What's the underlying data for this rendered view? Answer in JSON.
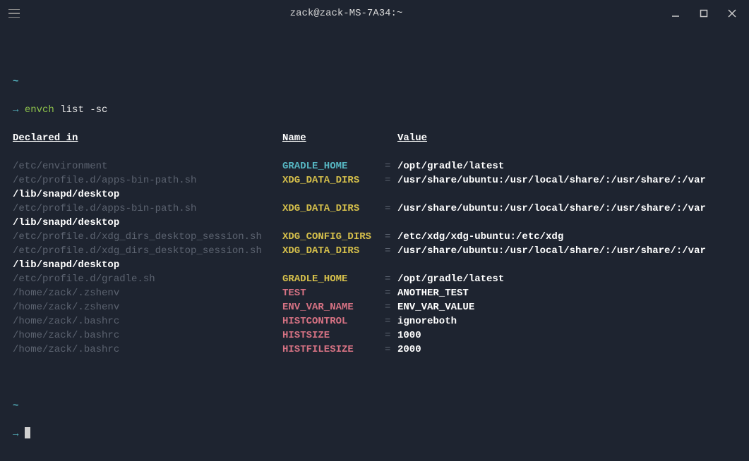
{
  "window": {
    "title": "zack@zack-MS-7A34:~"
  },
  "prompt": {
    "cwd": "~",
    "arrow": "→",
    "command": "envch",
    "args": "list -sc"
  },
  "headers": {
    "declared": "Declared in",
    "name": "Name",
    "value": "Value"
  },
  "eq": "=",
  "rows": [
    {
      "declared": "/etc/environment",
      "name": "GRADLE_HOME",
      "value": "/opt/gradle/latest",
      "nameClass": "cyan",
      "continuation": null
    },
    {
      "declared": "/etc/profile.d/apps-bin-path.sh",
      "name": "XDG_DATA_DIRS",
      "value": "/usr/share/ubuntu:/usr/local/share/:/usr/share/:/var",
      "nameClass": "yellow",
      "continuation": "/lib/snapd/desktop"
    },
    {
      "declared": "/etc/profile.d/apps-bin-path.sh",
      "name": "XDG_DATA_DIRS",
      "value": "/usr/share/ubuntu:/usr/local/share/:/usr/share/:/var",
      "nameClass": "yellow",
      "continuation": "/lib/snapd/desktop"
    },
    {
      "declared": "/etc/profile.d/xdg_dirs_desktop_session.sh",
      "name": "XDG_CONFIG_DIRS",
      "value": "/etc/xdg/xdg-ubuntu:/etc/xdg",
      "nameClass": "yellow",
      "continuation": null
    },
    {
      "declared": "/etc/profile.d/xdg_dirs_desktop_session.sh",
      "name": "XDG_DATA_DIRS",
      "value": "/usr/share/ubuntu:/usr/local/share/:/usr/share/:/var",
      "nameClass": "yellow",
      "continuation": "/lib/snapd/desktop"
    },
    {
      "declared": "/etc/profile.d/gradle.sh",
      "name": "GRADLE_HOME",
      "value": "/opt/gradle/latest",
      "nameClass": "yellow",
      "continuation": null
    },
    {
      "declared": "/home/zack/.zshenv",
      "name": "TEST",
      "value": "ANOTHER_TEST",
      "nameClass": "red-pink",
      "continuation": null
    },
    {
      "declared": "/home/zack/.zshenv",
      "name": "ENV_VAR_NAME",
      "value": "ENV_VAR_VALUE",
      "nameClass": "red-pink",
      "continuation": null
    },
    {
      "declared": "/home/zack/.bashrc",
      "name": "HISTCONTROL",
      "value": "ignoreboth",
      "nameClass": "red-pink",
      "continuation": null
    },
    {
      "declared": "/home/zack/.bashrc",
      "name": "HISTSIZE",
      "value": "1000",
      "nameClass": "red-pink",
      "continuation": null
    },
    {
      "declared": "/home/zack/.bashrc",
      "name": "HISTFILESIZE",
      "value": "2000",
      "nameClass": "red-pink",
      "continuation": null
    }
  ]
}
